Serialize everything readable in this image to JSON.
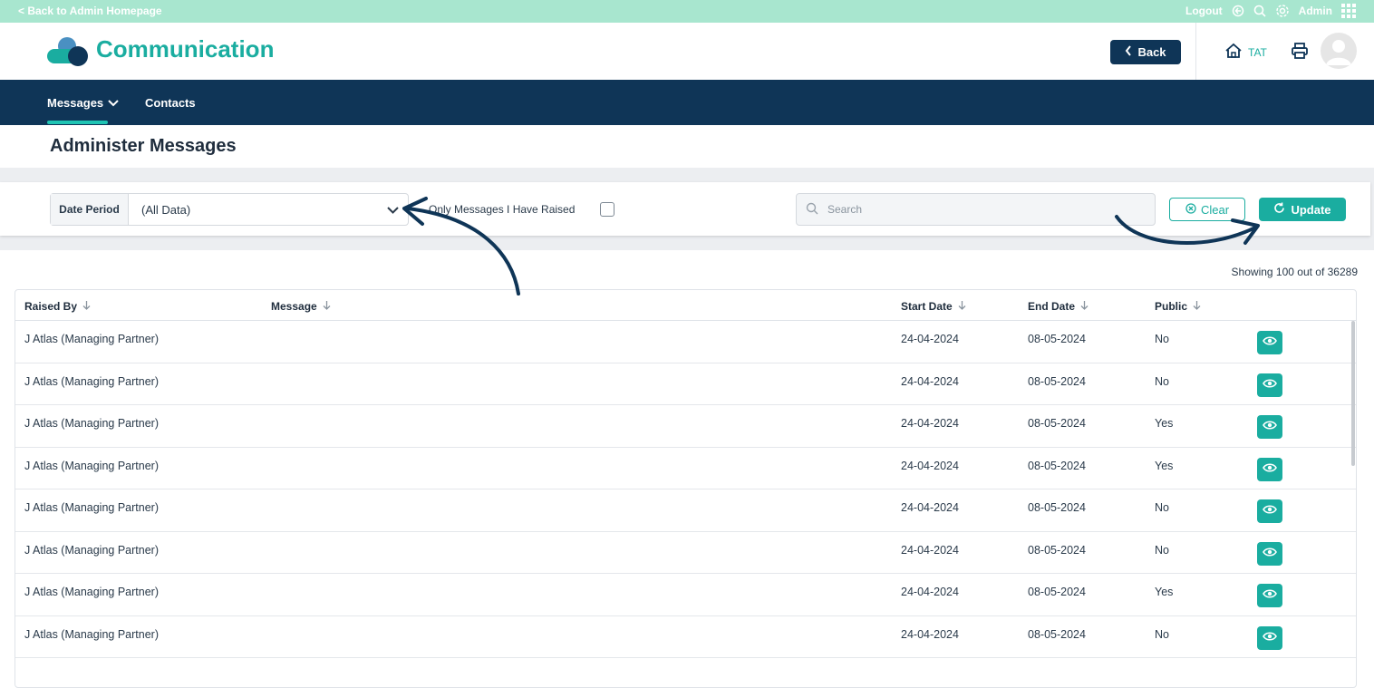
{
  "topbar": {
    "back_link": "< Back to Admin Homepage",
    "logout": "Logout",
    "user": "Admin"
  },
  "header": {
    "app_title": "Communication",
    "back_button": "Back",
    "home_label": "TAT"
  },
  "nav": {
    "messages": "Messages",
    "contacts": "Contacts"
  },
  "page": {
    "title": "Administer Messages"
  },
  "filters": {
    "date_period_label": "Date Period",
    "date_period_value": "(All Data)",
    "only_mine_label": "Only Messages I Have Raised",
    "only_mine_checked": false,
    "search_placeholder": "Search",
    "clear_label": "Clear",
    "update_label": "Update"
  },
  "results": {
    "showing": "Showing 100 out of 36289"
  },
  "table": {
    "columns": [
      "Raised By",
      "Message",
      "Start Date",
      "End Date",
      "Public"
    ],
    "rows": [
      {
        "raised_by": "J Atlas (Managing Partner)",
        "message": "",
        "start": "24-04-2024",
        "end": "08-05-2024",
        "public": "No"
      },
      {
        "raised_by": "J Atlas (Managing Partner)",
        "message": "",
        "start": "24-04-2024",
        "end": "08-05-2024",
        "public": "No"
      },
      {
        "raised_by": "J Atlas (Managing Partner)",
        "message": "",
        "start": "24-04-2024",
        "end": "08-05-2024",
        "public": "Yes"
      },
      {
        "raised_by": "J Atlas (Managing Partner)",
        "message": "",
        "start": "24-04-2024",
        "end": "08-05-2024",
        "public": "Yes"
      },
      {
        "raised_by": "J Atlas (Managing Partner)",
        "message": "",
        "start": "24-04-2024",
        "end": "08-05-2024",
        "public": "No"
      },
      {
        "raised_by": "J Atlas (Managing Partner)",
        "message": "",
        "start": "24-04-2024",
        "end": "08-05-2024",
        "public": "No"
      },
      {
        "raised_by": "J Atlas (Managing Partner)",
        "message": "",
        "start": "24-04-2024",
        "end": "08-05-2024",
        "public": "Yes"
      },
      {
        "raised_by": "J Atlas (Managing Partner)",
        "message": "",
        "start": "24-04-2024",
        "end": "08-05-2024",
        "public": "No"
      }
    ]
  },
  "colors": {
    "accent": "#1aada0",
    "navy": "#0f3557",
    "topbar": "#a8e6cf"
  },
  "icons": [
    "gear-icon",
    "search-icon",
    "logout-icon",
    "grid-icon",
    "home-icon",
    "printer-icon",
    "avatar-icon",
    "chevron-down-icon",
    "refresh-icon",
    "clear-icon",
    "eye-icon",
    "sort-arrow-icon"
  ]
}
